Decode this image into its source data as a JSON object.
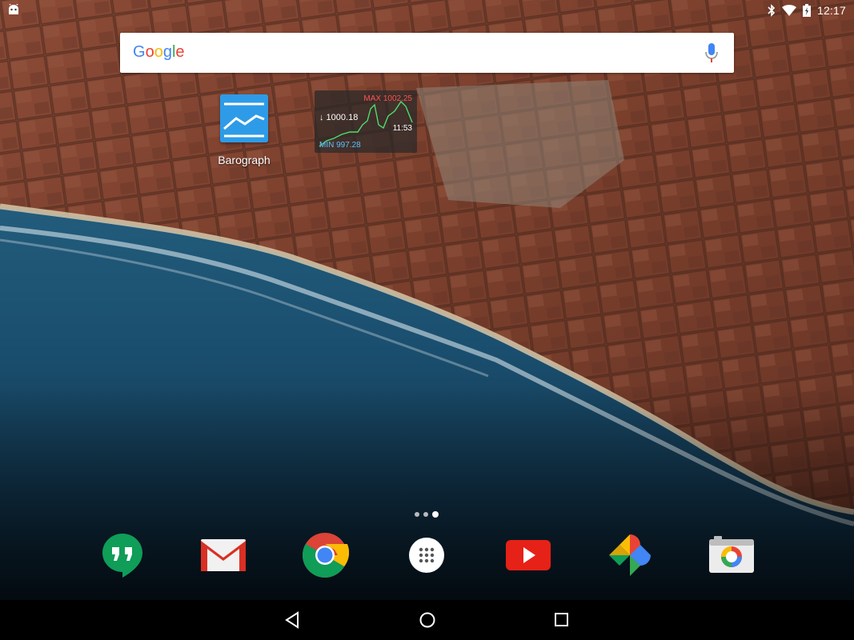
{
  "status_bar": {
    "time": "12:17",
    "icons": [
      "android-notification-icon",
      "bluetooth-icon",
      "wifi-icon",
      "battery-charging-icon"
    ]
  },
  "search": {
    "logo_text": "Google",
    "mic_icon": "mic-icon"
  },
  "home": {
    "apps": [
      {
        "label": "Barograph",
        "icon": "barograph-icon"
      }
    ],
    "widget": {
      "max_label": "MAX 1002.25",
      "current_value": "↓ 1000.18",
      "time": "11:53",
      "min_label": "MIN 997.28"
    },
    "page_indicator": {
      "pages": 3,
      "current": 3
    }
  },
  "dock": {
    "apps": [
      {
        "name": "Hangouts",
        "icon": "hangouts-icon",
        "color": "#0f9d58"
      },
      {
        "name": "Gmail",
        "icon": "gmail-icon",
        "color": "#d93025"
      },
      {
        "name": "Chrome",
        "icon": "chrome-icon",
        "color": "#4285f4"
      },
      {
        "name": "All apps",
        "icon": "app-drawer-icon",
        "color": "#ffffff"
      },
      {
        "name": "YouTube",
        "icon": "youtube-icon",
        "color": "#e62117"
      },
      {
        "name": "Photos",
        "icon": "photos-icon",
        "color": "#fbbc05"
      },
      {
        "name": "Camera",
        "icon": "camera-icon",
        "color": "#e0e0e0"
      }
    ]
  },
  "nav_bar": {
    "buttons": [
      "back-icon",
      "home-icon",
      "recents-icon"
    ]
  }
}
